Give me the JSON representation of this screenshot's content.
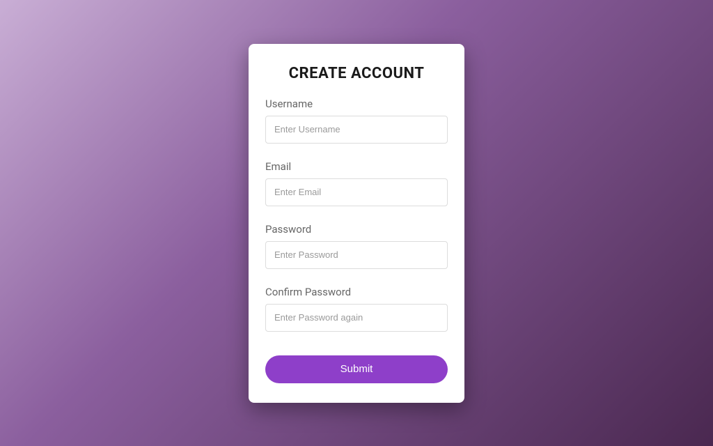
{
  "form": {
    "title": "CREATE ACCOUNT",
    "fields": {
      "username": {
        "label": "Username",
        "placeholder": "Enter Username",
        "value": ""
      },
      "email": {
        "label": "Email",
        "placeholder": "Enter Email",
        "value": ""
      },
      "password": {
        "label": "Password",
        "placeholder": "Enter Password",
        "value": ""
      },
      "confirm_password": {
        "label": "Confirm Password",
        "placeholder": "Enter Password again",
        "value": ""
      }
    },
    "submit_label": "Submit"
  },
  "colors": {
    "accent": "#8e3fc9"
  }
}
